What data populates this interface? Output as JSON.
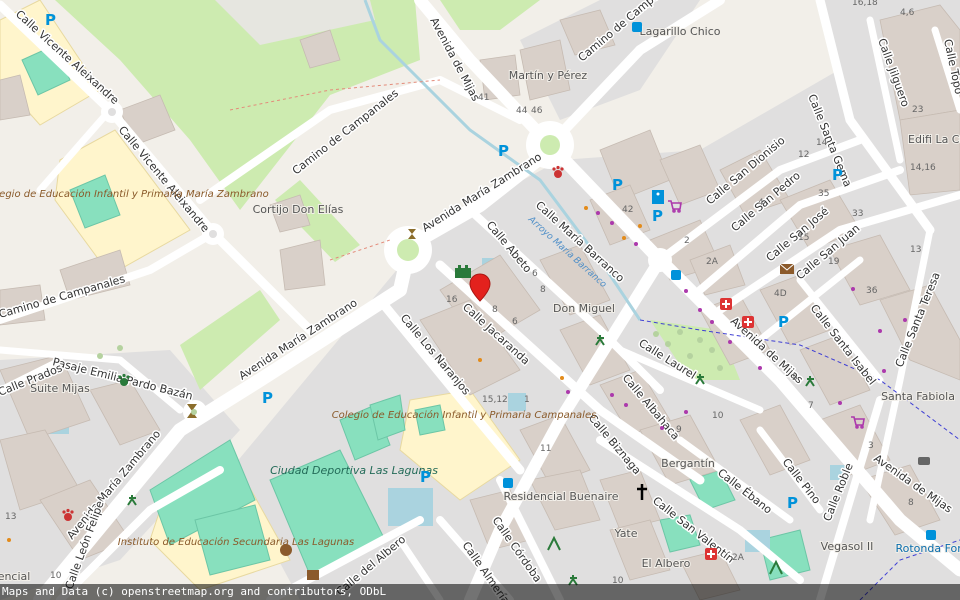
{
  "map": {
    "attribution": "Maps and Data (c) openstreetmap.org and contributors, ODbL",
    "colors": {
      "background": "#f2efe9",
      "park": "#cdebb0",
      "pitch": "#88e0be",
      "school": "#fff5cc",
      "residential": "#e0dfdf",
      "building": "#d9d0c9",
      "water": "#aad3df",
      "road": "#ffffff",
      "marker": "#e3211d"
    },
    "streets": [
      {
        "name": "Calle Vicente Aleixandre"
      },
      {
        "name": "Calle Vicente Aleixandre"
      },
      {
        "name": "Avenida de Mijas"
      },
      {
        "name": "Camino de Campanales"
      },
      {
        "name": "Camino de Campanales"
      },
      {
        "name": "Camino de Campanales"
      },
      {
        "name": "Avenida María Zambrano"
      },
      {
        "name": "Avenida María Zambrano"
      },
      {
        "name": "Avenida María Zambrano"
      },
      {
        "name": "Pasaje Emilia Pardo Bazán"
      },
      {
        "name": "Calle Los Naranjos"
      },
      {
        "name": "Calle Jacaranda"
      },
      {
        "name": "Calle Abeto"
      },
      {
        "name": "Calle María Barranco"
      },
      {
        "name": "Calle Santa Gema"
      },
      {
        "name": "Calle Jilguero"
      },
      {
        "name": "Calle San Dionisio"
      },
      {
        "name": "Calle San Pedro"
      },
      {
        "name": "Calle San José"
      },
      {
        "name": "Calle San Juan"
      },
      {
        "name": "Calle Santa Isabel"
      },
      {
        "name": "Calle Santa Teresa"
      },
      {
        "name": "Avenida de Mijas"
      },
      {
        "name": "Calle Laurel"
      },
      {
        "name": "Calle Albahaca"
      },
      {
        "name": "Calle Biznaga"
      },
      {
        "name": "Calle Ébano"
      },
      {
        "name": "Calle San Valentín"
      },
      {
        "name": "Calle Pino"
      },
      {
        "name": "Calle Roble"
      },
      {
        "name": "Avenida de Mijas"
      },
      {
        "name": "Calle León Felipe"
      },
      {
        "name": "Calle del Albero"
      },
      {
        "name": "Calle Córdoba"
      },
      {
        "name": "Calle Almería"
      },
      {
        "name": "Calle Topo"
      },
      {
        "name": "Calle Prados"
      }
    ],
    "places": [
      {
        "name": "Lagarillo Chico"
      },
      {
        "name": "Martín y Pérez"
      },
      {
        "name": "Cortijo Don Elías"
      },
      {
        "name": "Don Miguel"
      },
      {
        "name": "Suite Mijas"
      },
      {
        "name": "Residencial Buenaire"
      },
      {
        "name": "Bergantín"
      },
      {
        "name": "Yate"
      },
      {
        "name": "El Albero"
      },
      {
        "name": "Santa Fabiola"
      },
      {
        "name": "Vegasol II"
      },
      {
        "name": "Edifi La Caña"
      },
      {
        "name": "Rotonda Ford"
      },
      {
        "name": "encial"
      }
    ],
    "amenities": [
      {
        "name": "Colegio de Educación Infantil y Primaria María Zambrano"
      },
      {
        "name": "Colegio de Educación Infantil y Primaria Campanales"
      },
      {
        "name": "Ciudad Deportiva Las Lagunas"
      },
      {
        "name": "Instituto de Educación Secundaria Las Lagunas"
      }
    ],
    "water_label": "Arroyo María Barranco",
    "parking_label": "P",
    "house_numbers": [
      "41",
      "44",
      "46",
      "42",
      "2",
      "2A",
      "4",
      "6",
      "8",
      "10",
      "12",
      "14",
      "16",
      "13",
      "15",
      "19",
      "23",
      "33",
      "35",
      "36",
      "4D",
      "5",
      "7",
      "9",
      "11",
      "1",
      "3",
      "14,16",
      "16,18",
      "4,6",
      "10",
      "15,12",
      "6",
      "8",
      "13",
      "10",
      "2A",
      "8",
      "6"
    ],
    "marker": {
      "icon": "map-pin-marker"
    }
  }
}
